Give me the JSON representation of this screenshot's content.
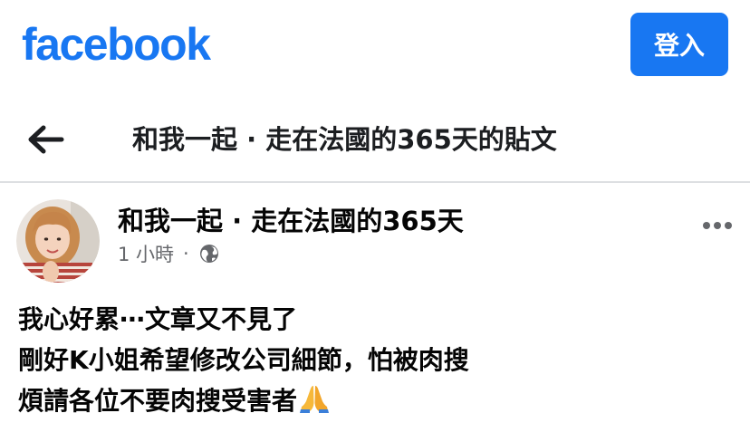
{
  "header": {
    "logo_text": "facebook",
    "login_label": "登入"
  },
  "nav": {
    "title": "和我一起 · 走在法國的365天的貼文"
  },
  "post": {
    "author": "和我一起 · 走在法國的365天",
    "time": "1 小時",
    "separator": "·",
    "privacy_icon": "globe-icon",
    "more_icon": "more-options-icon",
    "lines": [
      "我心好累⋯文章又不見了",
      "剛好K小姐希望修改公司細節，怕被肉搜",
      "煩請各位不要肉搜受害者"
    ],
    "emoji": "folded-hands-emoji"
  },
  "colors": {
    "brand": "#1877f2",
    "divider": "#dddfe2",
    "secondary_text": "#65676b"
  }
}
